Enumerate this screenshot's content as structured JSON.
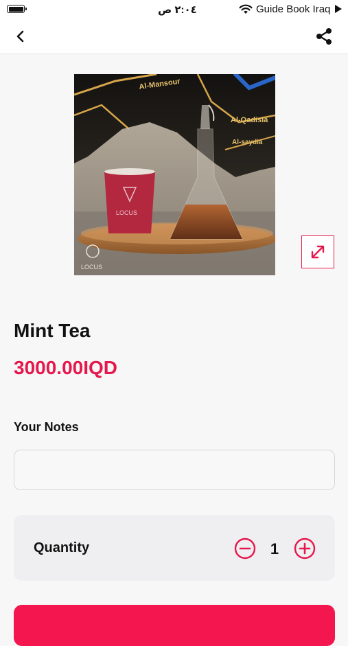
{
  "status_bar": {
    "time": "٢:٠٤ ص",
    "carrier": "Guide Book Iraq"
  },
  "nav": {
    "back_icon": "chevron-left-icon",
    "share_icon": "share-icon"
  },
  "product": {
    "name": "Mint Tea",
    "price": "3000.00IQD",
    "image_icon": "product-photo",
    "image_texts": [
      "Al-Mansour",
      "Al-Qadisia",
      "Al-saydia",
      "LOCUS",
      "LOCUS"
    ]
  },
  "notes": {
    "label": "Your Notes",
    "value": "",
    "placeholder": ""
  },
  "quantity": {
    "label": "Quantity",
    "value": "1"
  },
  "colors": {
    "accent": "#e5184d",
    "button": "#f4164f",
    "background": "#f7f7f7",
    "card": "#efeff1"
  }
}
